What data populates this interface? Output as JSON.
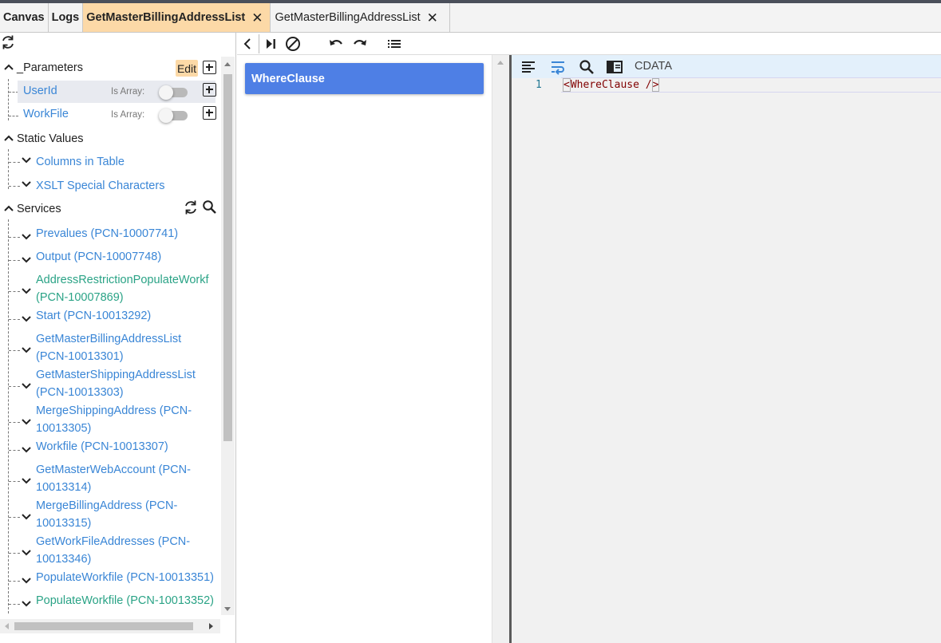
{
  "tabs": [
    {
      "label": "Canvas",
      "active": false,
      "closable": false
    },
    {
      "label": "Logs",
      "active": false,
      "closable": false
    },
    {
      "label": "GetMasterBillingAddressList",
      "active": true,
      "closable": true
    },
    {
      "label": "GetMasterBillingAddressList",
      "active": false,
      "closable": true
    }
  ],
  "tab_close_glyph": "✕",
  "sidebar": {
    "parameters": {
      "label": "_Parameters",
      "edit_label": "Edit",
      "items": [
        {
          "name": "UserId",
          "is_array_label": "Is Array:",
          "is_array": false,
          "selected": true
        },
        {
          "name": "WorkFile",
          "is_array_label": "Is Array:",
          "is_array": false,
          "selected": false
        }
      ]
    },
    "static_values": {
      "label": "Static Values",
      "items": [
        "Columns in Table",
        "XSLT Special Characters"
      ]
    },
    "services": {
      "label": "Services",
      "items": [
        {
          "lines": [
            "Prevalues (PCN-10007741)"
          ],
          "color": "blue"
        },
        {
          "lines": [
            "Output (PCN-10007748)"
          ],
          "color": "blue"
        },
        {
          "lines": [
            "AddressRestrictionPopulateWorkf",
            "(PCN-10007869)"
          ],
          "color": "green"
        },
        {
          "lines": [
            "Start (PCN-10013292)"
          ],
          "color": "blue"
        },
        {
          "lines": [
            "GetMasterBillingAddressList",
            "(PCN-10013301)"
          ],
          "color": "blue"
        },
        {
          "lines": [
            "GetMasterShippingAddressList",
            "(PCN-10013303)"
          ],
          "color": "blue"
        },
        {
          "lines": [
            "MergeShippingAddress (PCN-",
            "10013305)"
          ],
          "color": "blue"
        },
        {
          "lines": [
            "Workfile (PCN-10013307)"
          ],
          "color": "blue"
        },
        {
          "lines": [
            "GetMasterWebAccount (PCN-",
            "10013314)"
          ],
          "color": "blue"
        },
        {
          "lines": [
            "MergeBillingAddress (PCN-",
            "10013315)"
          ],
          "color": "blue"
        },
        {
          "lines": [
            "GetWorkFileAddresses (PCN-",
            "10013346)"
          ],
          "color": "blue"
        },
        {
          "lines": [
            "PopulateWorkfile (PCN-10013351)"
          ],
          "color": "blue"
        },
        {
          "lines": [
            "PopulateWorkfile (PCN-10013352)"
          ],
          "color": "green"
        }
      ]
    }
  },
  "colors": {
    "link_blue": "#3a86d6",
    "link_green": "#2aa386",
    "active_tab": "#fcd9a7",
    "block_blue": "#4e7fe5",
    "editor_toolbar": "#e3f0fb"
  },
  "canvas": {
    "block_label": "WhereClause"
  },
  "editor": {
    "cdata_label": "CDATA",
    "line_number": "1",
    "code_open": "<",
    "code_body": "WhereClause /",
    "code_close": ">"
  }
}
